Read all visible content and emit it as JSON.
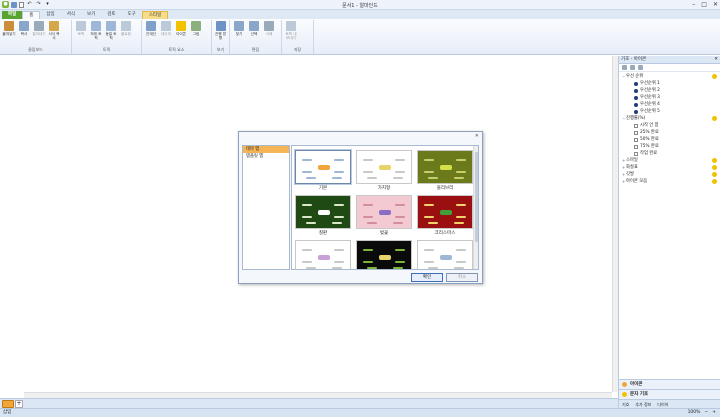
{
  "window": {
    "title": "문서1 - 알마인드"
  },
  "qat_icons": [
    "app-logo-icon",
    "save-icon",
    "new-icon",
    "undo-icon",
    "redo-icon",
    "customize-icon"
  ],
  "tabs": [
    {
      "label": "파일",
      "kind": "file"
    },
    {
      "label": "홈",
      "kind": "active"
    },
    {
      "label": "삽입",
      "kind": ""
    },
    {
      "label": "서식",
      "kind": ""
    },
    {
      "label": "보기",
      "kind": ""
    },
    {
      "label": "검토",
      "kind": ""
    },
    {
      "label": "도구",
      "kind": ""
    },
    {
      "label": "스타일",
      "kind": "ctx"
    }
  ],
  "ribbon": {
    "groups": [
      {
        "label": "클립보드",
        "buttons": [
          {
            "label": "붙여넣기",
            "color": "#c98d3c",
            "disabled": false
          },
          {
            "label": "복사",
            "color": "#8aa6c9",
            "disabled": false
          },
          {
            "label": "잘라내기",
            "color": "#9ab",
            "disabled": true
          },
          {
            "label": "서식 복사",
            "color": "#d6a64a",
            "disabled": false
          }
        ]
      },
      {
        "label": "토픽",
        "buttons": [
          {
            "label": "토픽",
            "color": "#bcc9d9",
            "disabled": true
          },
          {
            "label": "하위 토픽",
            "color": "#9fb7d6",
            "disabled": false
          },
          {
            "label": "동일 토픽",
            "color": "#9fb7d6",
            "disabled": false
          },
          {
            "label": "플로팅",
            "color": "#bcc9d9",
            "disabled": true
          }
        ]
      },
      {
        "label": "토픽 요소",
        "buttons": [
          {
            "label": "관계선",
            "color": "#7fa0c8",
            "disabled": false
          },
          {
            "label": "테두리",
            "color": "#bcc9d9",
            "disabled": true
          },
          {
            "label": "아이콘",
            "color": "#f2c200",
            "disabled": false
          },
          {
            "label": "그림",
            "color": "#8bb07d",
            "disabled": false
          }
        ]
      },
      {
        "label": "보기",
        "buttons": [
          {
            "label": "진행 방향",
            "color": "#6d93c6",
            "disabled": false
          }
        ]
      },
      {
        "label": "편집",
        "buttons": [
          {
            "label": "찾기",
            "color": "#8aa6c9",
            "disabled": false
          },
          {
            "label": "선택",
            "color": "#8aa6c9",
            "disabled": false
          },
          {
            "label": "삭제",
            "color": "#9ab",
            "disabled": true
          }
        ]
      },
      {
        "label": "저장",
        "buttons": [
          {
            "label": "토픽 내보내기",
            "color": "#bcc9d9",
            "disabled": true
          }
        ]
      }
    ]
  },
  "right_panel": {
    "title": "기호 - 아이콘",
    "tree": [
      {
        "label": "우선 순위",
        "level": 0,
        "toggle": "−",
        "marker": "none",
        "star": true
      },
      {
        "label": "우선순위 1",
        "level": 1,
        "toggle": "",
        "marker": "bullet",
        "star": false
      },
      {
        "label": "우선순위 2",
        "level": 1,
        "toggle": "",
        "marker": "bullet",
        "star": false
      },
      {
        "label": "우선순위 3",
        "level": 1,
        "toggle": "",
        "marker": "bullet",
        "star": false
      },
      {
        "label": "우선순위 4",
        "level": 1,
        "toggle": "",
        "marker": "bullet",
        "star": false
      },
      {
        "label": "우선순위 5",
        "level": 1,
        "toggle": "",
        "marker": "bullet",
        "star": false
      },
      {
        "label": "진행률(%)",
        "level": 0,
        "toggle": "−",
        "marker": "none",
        "star": true
      },
      {
        "label": "시작 안 함",
        "level": 1,
        "toggle": "",
        "marker": "check",
        "star": false
      },
      {
        "label": "25% 완료",
        "level": 1,
        "toggle": "",
        "marker": "check",
        "star": false
      },
      {
        "label": "50% 완료",
        "level": 1,
        "toggle": "",
        "marker": "check",
        "star": false
      },
      {
        "label": "75% 완료",
        "level": 1,
        "toggle": "",
        "marker": "check",
        "star": false
      },
      {
        "label": "작업 완료",
        "level": 1,
        "toggle": "",
        "marker": "check",
        "star": false
      },
      {
        "label": "스마일",
        "level": 0,
        "toggle": "+",
        "marker": "none",
        "star": true
      },
      {
        "label": "화살표",
        "level": 0,
        "toggle": "+",
        "marker": "none",
        "star": true
      },
      {
        "label": "깃발",
        "level": 0,
        "toggle": "+",
        "marker": "none",
        "star": true
      },
      {
        "label": "아이콘 모음",
        "level": 0,
        "toggle": "+",
        "marker": "none",
        "star": true
      }
    ],
    "bottom_rows": [
      "아이콘",
      "문자 기호"
    ],
    "footer": [
      "기호",
      "추가 정보",
      "다이어"
    ]
  },
  "dialog": {
    "categories": [
      {
        "label": "테마 맵",
        "selected": true
      },
      {
        "label": "템플릿 맵",
        "selected": false
      }
    ],
    "themes": [
      {
        "label": "기본",
        "bg": "#ffffff",
        "accent": "#f2a53a",
        "line": "#9fb7d6",
        "selected": true
      },
      {
        "label": "가지형",
        "bg": "#ffffff",
        "accent": "#e6d36b",
        "line": "#c8c8c8",
        "selected": false
      },
      {
        "label": "올리브리",
        "bg": "#6b7a1a",
        "accent": "#d6e04a",
        "line": "#c8cf6a",
        "selected": false
      },
      {
        "label": "칠판",
        "bg": "#1f4a14",
        "accent": "#ffffff",
        "line": "#d8e8c8",
        "selected": false
      },
      {
        "label": "벚꽃",
        "bg": "#f3c9d2",
        "accent": "#8a6ec6",
        "line": "#d48ca0",
        "selected": false
      },
      {
        "label": "크리스마스",
        "bg": "#9a1010",
        "accent": "#3fa13a",
        "line": "#f2d36b",
        "selected": false
      },
      {
        "label": "",
        "bg": "#ffffff",
        "accent": "#c9a0d8",
        "line": "#c8c8c8",
        "selected": false
      },
      {
        "label": "",
        "bg": "#0a0a0a",
        "accent": "#e6d36b",
        "line": "#7bb536",
        "selected": false
      },
      {
        "label": "",
        "bg": "#ffffff",
        "accent": "#9fb7d6",
        "line": "#c8c8c8",
        "selected": false
      }
    ],
    "ok_label": "확인",
    "cancel_label": "취소"
  },
  "status": {
    "left": "삽입",
    "zoom": "100%"
  }
}
